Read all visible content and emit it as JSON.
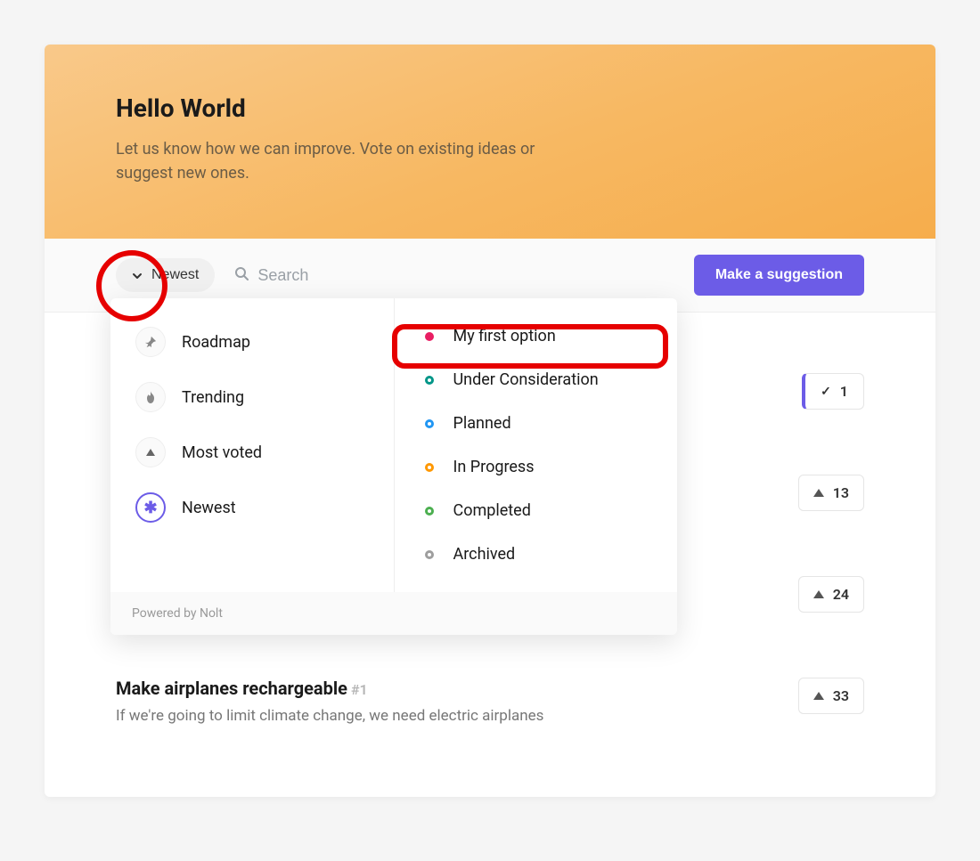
{
  "hero": {
    "title": "Hello World",
    "subtitle": "Let us know how we can improve. Vote on existing ideas or suggest new ones."
  },
  "toolbar": {
    "sort_label": "Newest",
    "search_placeholder": "Search",
    "suggest_label": "Make a suggestion"
  },
  "dropdown": {
    "sort_options": [
      {
        "label": "Roadmap",
        "icon": "thumbtack"
      },
      {
        "label": "Trending",
        "icon": "flame"
      },
      {
        "label": "Most voted",
        "icon": "triangle"
      },
      {
        "label": "Newest",
        "icon": "asterisk",
        "selected": true
      }
    ],
    "status_options": [
      {
        "label": "My first option",
        "color": "#e91e63",
        "style": "dot"
      },
      {
        "label": "Under Consideration",
        "color": "#009688",
        "style": "ring"
      },
      {
        "label": "Planned",
        "color": "#2196f3",
        "style": "ring"
      },
      {
        "label": "In Progress",
        "color": "#ff9800",
        "style": "ring"
      },
      {
        "label": "Completed",
        "color": "#4caf50",
        "style": "ring"
      },
      {
        "label": "Archived",
        "color": "#9e9e9e",
        "style": "ring"
      }
    ],
    "footer": "Powered by Nolt"
  },
  "suggestions": [
    {
      "votes": "1",
      "voted": true
    },
    {
      "votes": "13",
      "voted": false
    },
    {
      "votes": "24",
      "voted": false
    },
    {
      "title": "Make airplanes rechargeable",
      "id": "#1",
      "desc": "If we're going to limit climate change, we need electric airplanes",
      "votes": "33",
      "voted": false
    }
  ]
}
